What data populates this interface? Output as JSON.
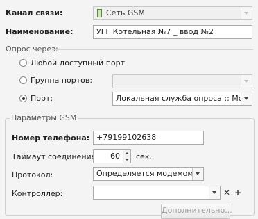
{
  "channel": {
    "label": "Канал связи:",
    "value": "Сеть GSM"
  },
  "name": {
    "label": "Наименование:",
    "value": "УГГ Котельная №7 _ ввод №2"
  },
  "poll": {
    "label": "Опрос через:",
    "options": [
      {
        "label": "Любой доступный порт",
        "checked": false
      },
      {
        "label": "Группа портов:",
        "checked": false
      },
      {
        "label": "Порт:",
        "checked": true
      }
    ],
    "port_value": "Локальная служба опроса :: Модем GSM"
  },
  "gsm": {
    "title": "Параметры GSM",
    "phone": {
      "label": "Номер телефона:",
      "value": "+79199102638"
    },
    "timeout": {
      "label": "Таймаут соединения:",
      "value": "60",
      "unit": "сек."
    },
    "protocol": {
      "label": "Протокол:",
      "value": "Определяется модемом"
    },
    "controller": {
      "label": "Контроллер:",
      "value": ""
    },
    "more_button": "Дополнительно..."
  }
}
